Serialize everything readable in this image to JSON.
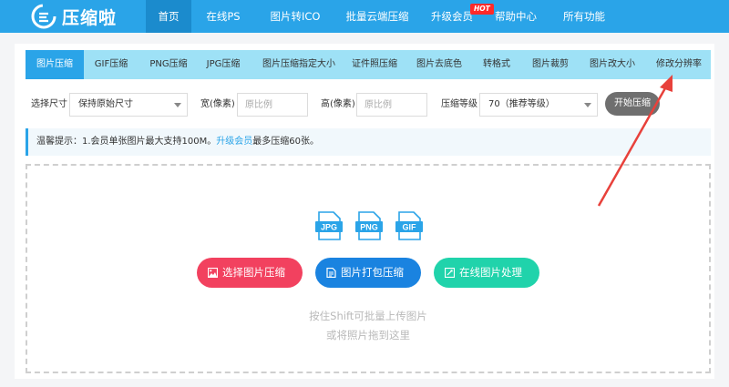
{
  "brand": {
    "name": "压缩啦"
  },
  "nav": {
    "items": [
      {
        "label": "首页",
        "active": true
      },
      {
        "label": "在线PS"
      },
      {
        "label": "图片转ICO"
      },
      {
        "label": "批量云端压缩"
      },
      {
        "label": "升级会员"
      },
      {
        "label": "帮助中心"
      },
      {
        "label": "所有功能"
      }
    ],
    "hot_badge": "HOT"
  },
  "tabs": [
    {
      "label": "图片压缩",
      "active": true
    },
    {
      "label": "GIF压缩"
    },
    {
      "label": "PNG压缩"
    },
    {
      "label": "JPG压缩"
    },
    {
      "label": "图片压缩指定大小"
    },
    {
      "label": "证件照压缩"
    },
    {
      "label": "图片去底色"
    },
    {
      "label": "转格式"
    },
    {
      "label": "图片裁剪"
    },
    {
      "label": "图片改大小"
    },
    {
      "label": "修改分辨率"
    }
  ],
  "options": {
    "size_label": "选择尺寸",
    "size_value": "保持原始尺寸",
    "width_label": "宽(像素)",
    "width_placeholder": "原比例",
    "height_label": "高(像素)",
    "height_placeholder": "原比例",
    "level_label": "压缩等级",
    "level_value": "70（推荐等级）",
    "start_label": "开始压缩"
  },
  "tip": {
    "prefix": "温馨提示：1.会员单张图片最大支持100M。",
    "link": "升级会员",
    "suffix": "最多压缩60张。"
  },
  "formats": [
    "JPG",
    "PNG",
    "GIF"
  ],
  "actions": {
    "select": "选择图片压缩",
    "pack": "图片打包压缩",
    "online": "在线图片处理"
  },
  "hints": {
    "line1": "按住Shift可批量上传图片",
    "line2": "或将照片拖到这里"
  },
  "colors": {
    "primary": "#2aa4e8",
    "tab_bar": "#9ee1f6",
    "red_button": "#f2415f",
    "blue_button": "#1a83e0",
    "green_button": "#20d3ab",
    "arrow": "#e8413b"
  }
}
